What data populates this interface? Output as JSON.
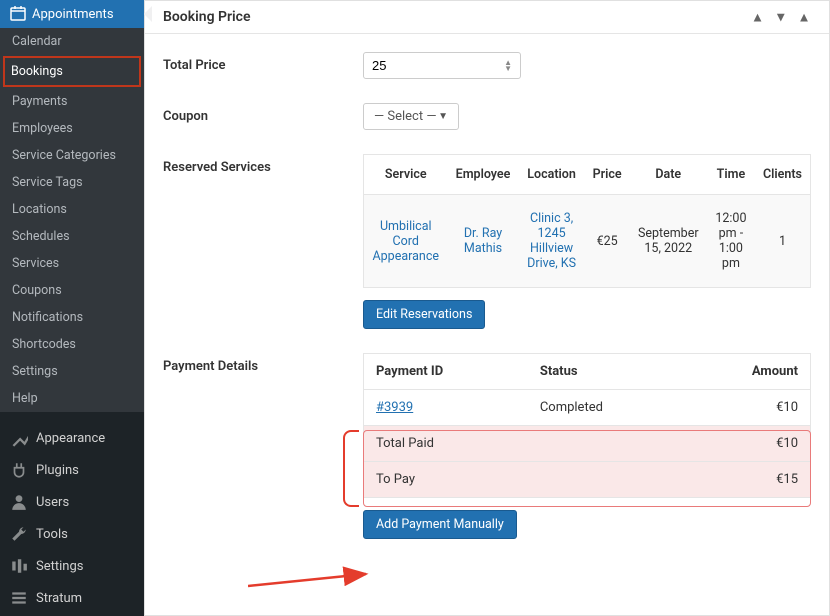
{
  "sidebar": {
    "top": "Appointments",
    "submenu": [
      "Calendar",
      "Bookings",
      "Payments",
      "Employees",
      "Service Categories",
      "Service Tags",
      "Locations",
      "Schedules",
      "Services",
      "Coupons",
      "Notifications",
      "Shortcodes",
      "Settings",
      "Help"
    ],
    "activeIndex": 1,
    "main": [
      "Appearance",
      "Plugins",
      "Users",
      "Tools",
      "Settings",
      "Stratum"
    ]
  },
  "panel": {
    "title": "Booking Price"
  },
  "totalPrice": {
    "label": "Total Price",
    "value": "25"
  },
  "coupon": {
    "label": "Coupon",
    "placeholder": "— Select —"
  },
  "reserved": {
    "label": "Reserved Services",
    "headers": [
      "Service",
      "Employee",
      "Location",
      "Price",
      "Date",
      "Time",
      "Clients"
    ],
    "row": {
      "service": "Umbilical Cord Appearance",
      "employee": "Dr. Ray Mathis",
      "location": "Clinic 3, 1245 Hillview Drive, KS",
      "price": "€25",
      "date": "September 15, 2022",
      "time": "12:00 pm - 1:00 pm",
      "clients": "1"
    },
    "editBtn": "Edit Reservations"
  },
  "payments": {
    "label": "Payment Details",
    "headers": [
      "Payment ID",
      "Status",
      "Amount"
    ],
    "row": {
      "id": "#3939",
      "status": "Completed",
      "amount": "€10"
    },
    "totalPaidLabel": "Total Paid",
    "totalPaid": "€10",
    "toPayLabel": "To Pay",
    "toPay": "€15",
    "addBtn": "Add Payment Manually"
  }
}
